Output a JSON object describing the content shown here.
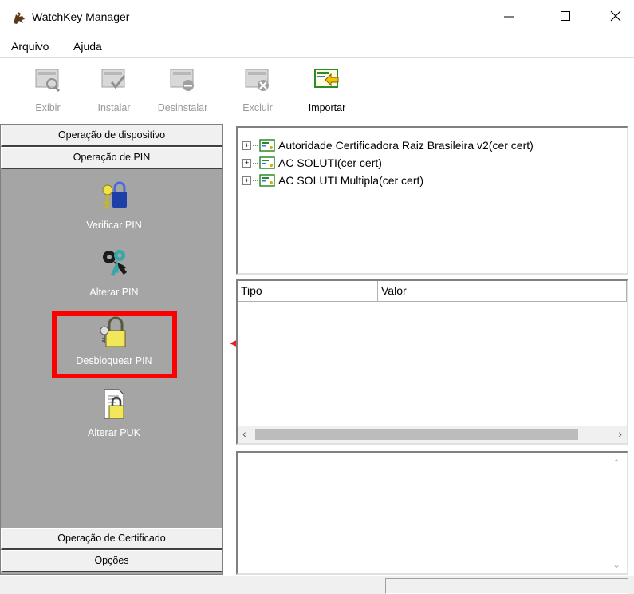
{
  "window": {
    "title": "WatchKey Manager",
    "app_icon": "watchkey-app-icon",
    "controls": {
      "minimize": "minimize-icon",
      "maximize": "maximize-icon",
      "close": "close-icon"
    }
  },
  "menubar": {
    "items": [
      {
        "label": "Arquivo"
      },
      {
        "label": "Ajuda"
      }
    ]
  },
  "toolbar": {
    "buttons": [
      {
        "label": "Exibir",
        "icon": "view-cert-icon",
        "enabled": false
      },
      {
        "label": "Instalar",
        "icon": "install-cert-icon",
        "enabled": false
      },
      {
        "label": "Desinstalar",
        "icon": "uninstall-cert-icon",
        "enabled": false
      },
      {
        "label": "Excluir",
        "icon": "delete-cert-icon",
        "enabled": false
      },
      {
        "label": "Importar",
        "icon": "import-cert-icon",
        "enabled": true
      }
    ]
  },
  "left_panel": {
    "headers_top": [
      "Operação de dispositivo",
      "Operação de PIN"
    ],
    "items": [
      {
        "label": "Verificar PIN",
        "icon": "verify-pin-key-lock-icon"
      },
      {
        "label": "Alterar PIN",
        "icon": "change-pin-keys-icon"
      },
      {
        "label": "Desbloquear PIN",
        "icon": "unblock-pin-padlock-icon"
      },
      {
        "label": "Alterar PUK",
        "icon": "change-puk-document-lock-icon"
      }
    ],
    "headers_bottom": [
      "Operação de Certificado",
      "Opções"
    ]
  },
  "tree": {
    "items": [
      {
        "label": "Autoridade Certificadora Raiz Brasileira v2(cer cert)",
        "icon": "certificate-icon"
      },
      {
        "label": "AC SOLUTI(cer cert)",
        "icon": "certificate-icon"
      },
      {
        "label": "AC SOLUTI Multipla(cer cert)",
        "icon": "certificate-icon"
      }
    ]
  },
  "list": {
    "columns": [
      "Tipo",
      "Valor"
    ]
  },
  "annotation": {
    "highlight_color": "#ff0000"
  },
  "colors": {
    "panel_bg": "#a5a5a5",
    "accent_red": "#ff0000"
  }
}
